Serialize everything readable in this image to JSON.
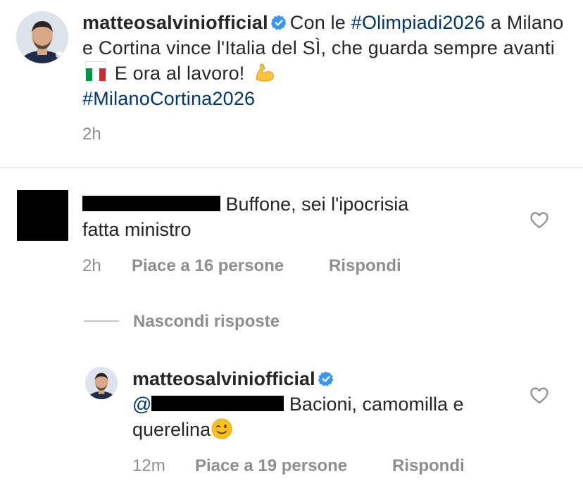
{
  "post": {
    "username": "matteosalviniofficial",
    "caption_prefix": "Con le ",
    "hashtag_1": "#Olimpiadi2026",
    "caption_mid": " a Milano e Cortina vince l'Italia del SÌ, che guarda sempre avanti ",
    "caption_after_flag": " E ora al lavoro! ",
    "hashtag_2": "#MilanoCortina2026",
    "time": "2h"
  },
  "comment": {
    "text_1": "Buffone, sei l'ipocrisia",
    "text_2": "fatta ministro",
    "time": "2h",
    "likes": "Piace a 16 persone",
    "reply": "Rispondi"
  },
  "hide_replies": "Nascondi risposte",
  "reply": {
    "username": "matteosalviniofficial",
    "mention": "@",
    "text_1": " Bacioni, camomilla e",
    "text_2": "querelina",
    "time": "12m",
    "likes": "Piace a 19 persone",
    "reply": "Rispondi"
  },
  "colors": {
    "hashtag": "#003569",
    "meta": "#8e8e8e",
    "verified": "#3897f0",
    "divider": "#dbdbdb"
  },
  "icons": [
    "verified-badge-icon",
    "heart-icon",
    "italy-flag-emoji",
    "flexed-biceps-emoji",
    "winking-face-emoji"
  ]
}
